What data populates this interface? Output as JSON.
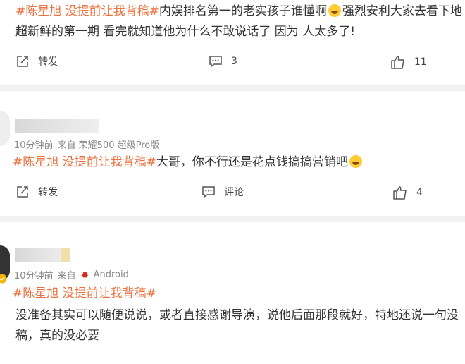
{
  "post1": {
    "hashtag": "#陈星旭 没提前让我背稿#",
    "line1_text": "内娱排名第一的老实孩子谁懂啊",
    "line1_text2": "强烈安利大家去看下地",
    "line2": "超新鲜的第一期 看完就知道他为什么不敢说话了 因为 人太多了!",
    "repost_label": "转发",
    "comment_count": "3",
    "like_count": "11"
  },
  "post2": {
    "meta_time": "10分钟前",
    "meta_source": "来自 荣耀500 超级Pro版",
    "hashtag": "#陈星旭 没提前让我背稿#",
    "text": "大哥，你不行还是花点钱搞搞营销吧",
    "repost_label": "转发",
    "comment_label": "评论",
    "like_count": "4"
  },
  "post3": {
    "meta_time": "10分钟前",
    "meta_source": "来自",
    "meta_device": "Android",
    "hashtag": "#陈星旭 没提前让我背稿#",
    "line1": "没准备其实可以随便说说，或者直接感谢导演，说他后面那段就好，特地还说一句没",
    "line2": "稿，真的没必要"
  },
  "colors": {
    "hashtag": "#eb7340",
    "text": "#333333",
    "meta": "#888888",
    "divider": "#f2f2f2"
  },
  "icons": [
    "repost-icon",
    "comment-icon",
    "like-icon",
    "laugh-emoji",
    "maple-leaf-icon",
    "verified-badge-icon"
  ]
}
